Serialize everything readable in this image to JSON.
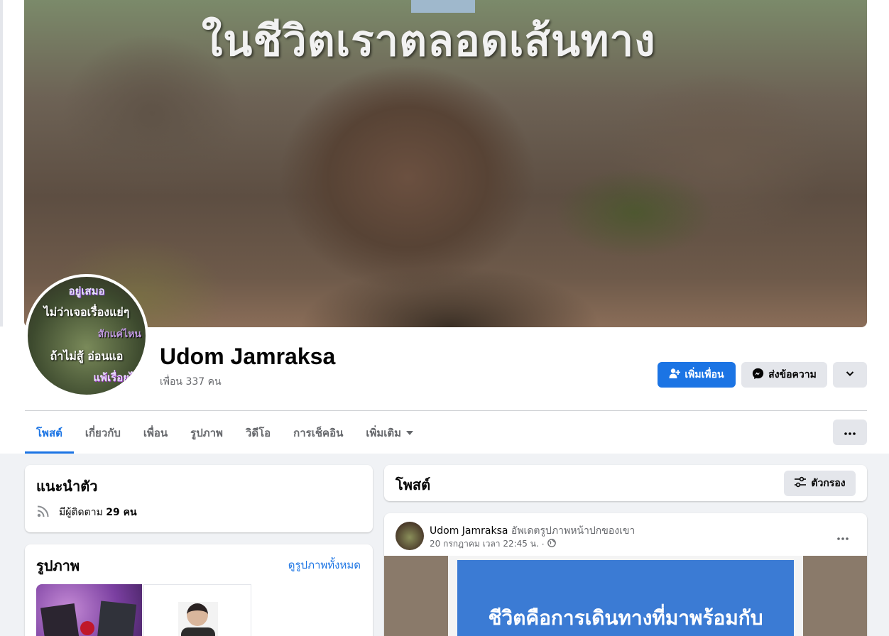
{
  "cover": {
    "overlay_text": "ในชีวิตเราตลอดเส้นทาง"
  },
  "avatar": {
    "line1": "อยู่เสมอ",
    "line2": "ไม่ว่าเจอเรื่องแย่ๆ",
    "line3": "สักแค่ไหน",
    "line4": "ถ้าไม่สู้ อ่อนแอ",
    "line5": "แพ้เรื่อยไป"
  },
  "profile": {
    "name": "Udom Jamraksa",
    "friends": "เพื่อน 337 คน"
  },
  "actions": {
    "add_friend": "เพิ่มเพื่อน",
    "message": "ส่งข้อความ"
  },
  "tabs": [
    {
      "label": "โพสต์"
    },
    {
      "label": "เกี่ยวกับ"
    },
    {
      "label": "เพื่อน"
    },
    {
      "label": "รูปภาพ"
    },
    {
      "label": "วิดีโอ"
    },
    {
      "label": "การเช็คอิน"
    },
    {
      "label": "เพิ่มเติม"
    }
  ],
  "intro": {
    "title": "แนะนำตัว",
    "followers_prefix": "มีผู้ติดตาม",
    "followers_value": "29 คน"
  },
  "photos": {
    "title": "รูปภาพ",
    "see_all": "ดูรูปภาพทั้งหมด"
  },
  "posts": {
    "title": "โพสต์",
    "filter": "ตัวกรอง"
  },
  "post": {
    "author": "Udom Jamraksa",
    "action": "อัพเดตรูปภาพหน้าปกของเขา",
    "time": "20 กรกฎาคม เวลา 22:45 น.",
    "separator": "·",
    "quote_line1": "ชีวิตคือการเดินทางที่มาพร้อมกับ"
  },
  "colors": {
    "accent": "#1b74e4",
    "background": "#f0f2f5",
    "secondary_button": "#e4e6eb"
  }
}
